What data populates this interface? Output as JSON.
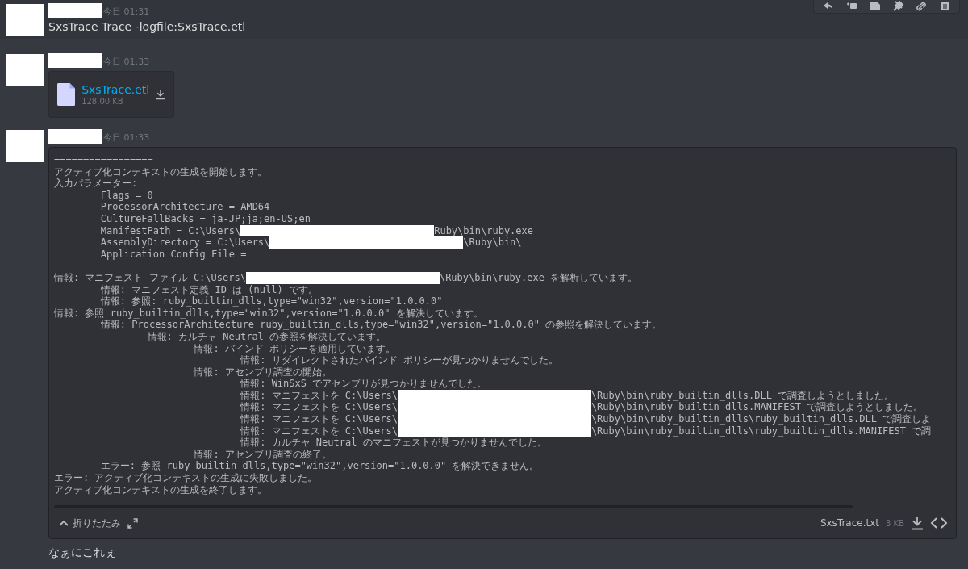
{
  "messages": [
    {
      "kind": "text",
      "highlighted": true,
      "time": "今日 01:31",
      "content": "SxsTrace Trace -logfile:SxsTrace.etl"
    },
    {
      "kind": "file",
      "highlighted": false,
      "time": "今日 01:33",
      "attachment": {
        "name": "SxsTrace.etl",
        "size": "128.00 KB"
      }
    },
    {
      "kind": "code",
      "highlighted": false,
      "time": "今日 01:33",
      "code_block": {
        "lines": [
          [
            "================="
          ],
          [
            "アクティブ化コンテキストの生成を開始します。"
          ],
          [
            "入力パラメーター:"
          ],
          [
            "\tFlags = 0"
          ],
          [
            "\tProcessorArchitecture = AMD64"
          ],
          [
            "\tCultureFallBacks = ja-JP;ja;en-US;en"
          ],
          [
            "\tManifestPath = C:\\Users\\",
            "Ruby\\bin\\ruby.exe"
          ],
          [
            "\tAssemblyDirectory = C:\\Users\\",
            "\\Ruby\\bin\\"
          ],
          [
            "\tApplication Config File = "
          ],
          [
            "-----------------"
          ],
          [
            "情報: マニフェスト ファイル C:\\Users\\",
            "\\Ruby\\bin\\ruby.exe を解析しています。"
          ],
          [
            "\t情報: マニフェスト定義 ID は (null) です。"
          ],
          [
            "\t情報: 参照: ruby_builtin_dlls,type=\"win32\",version=\"1.0.0.0\""
          ],
          [
            "情報: 参照 ruby_builtin_dlls,type=\"win32\",version=\"1.0.0.0\" を解決しています。"
          ],
          [
            "\t情報: ProcessorArchitecture ruby_builtin_dlls,type=\"win32\",version=\"1.0.0.0\" の参照を解決しています。"
          ],
          [
            "\t\t情報: カルチャ Neutral の参照を解決しています。"
          ],
          [
            "\t\t\t情報: バインド ポリシーを適用しています。"
          ],
          [
            "\t\t\t\t情報: リダイレクトされたバインド ポリシーが見つかりませんでした。"
          ],
          [
            "\t\t\t情報: アセンブリ調査の開始。"
          ],
          [
            "\t\t\t\t情報: WinSxS でアセンブリが見つかりませんでした。"
          ],
          [
            "\t\t\t\t情報: マニフェストを C:\\Users\\",
            "\\Ruby\\bin\\ruby_builtin_dlls.DLL で調査しようとしました。"
          ],
          [
            "\t\t\t\t情報: マニフェストを C:\\Users\\",
            "\\Ruby\\bin\\ruby_builtin_dlls.MANIFEST で調査しようとしました。"
          ],
          [
            "\t\t\t\t情報: マニフェストを C:\\Users\\",
            "\\Ruby\\bin\\ruby_builtin_dlls\\ruby_builtin_dlls.DLL で調査しよ"
          ],
          [
            "\t\t\t\t情報: マニフェストを C:\\Users\\",
            "\\Ruby\\bin\\ruby_builtin_dlls\\ruby_builtin_dlls.MANIFEST で調"
          ],
          [
            "\t\t\t\t情報: カルチャ Neutral のマニフェストが見つかりませんでした。"
          ],
          [
            "\t\t\t情報: アセンブリ調査の終了。"
          ],
          [
            "\tエラー: 参照 ruby_builtin_dlls,type=\"win32\",version=\"1.0.0.0\" を解決できません。"
          ],
          [
            "エラー: アクティブ化コンテキストの生成に失敗しました。"
          ],
          [
            "アクティブ化コンテキストの生成を終了します。"
          ]
        ],
        "collapse_label": "折りたたみ",
        "filename": "SxsTrace.txt",
        "size": "3 KB"
      }
    },
    {
      "kind": "text",
      "highlighted": false,
      "content": "なぁにこれぇ"
    }
  ]
}
